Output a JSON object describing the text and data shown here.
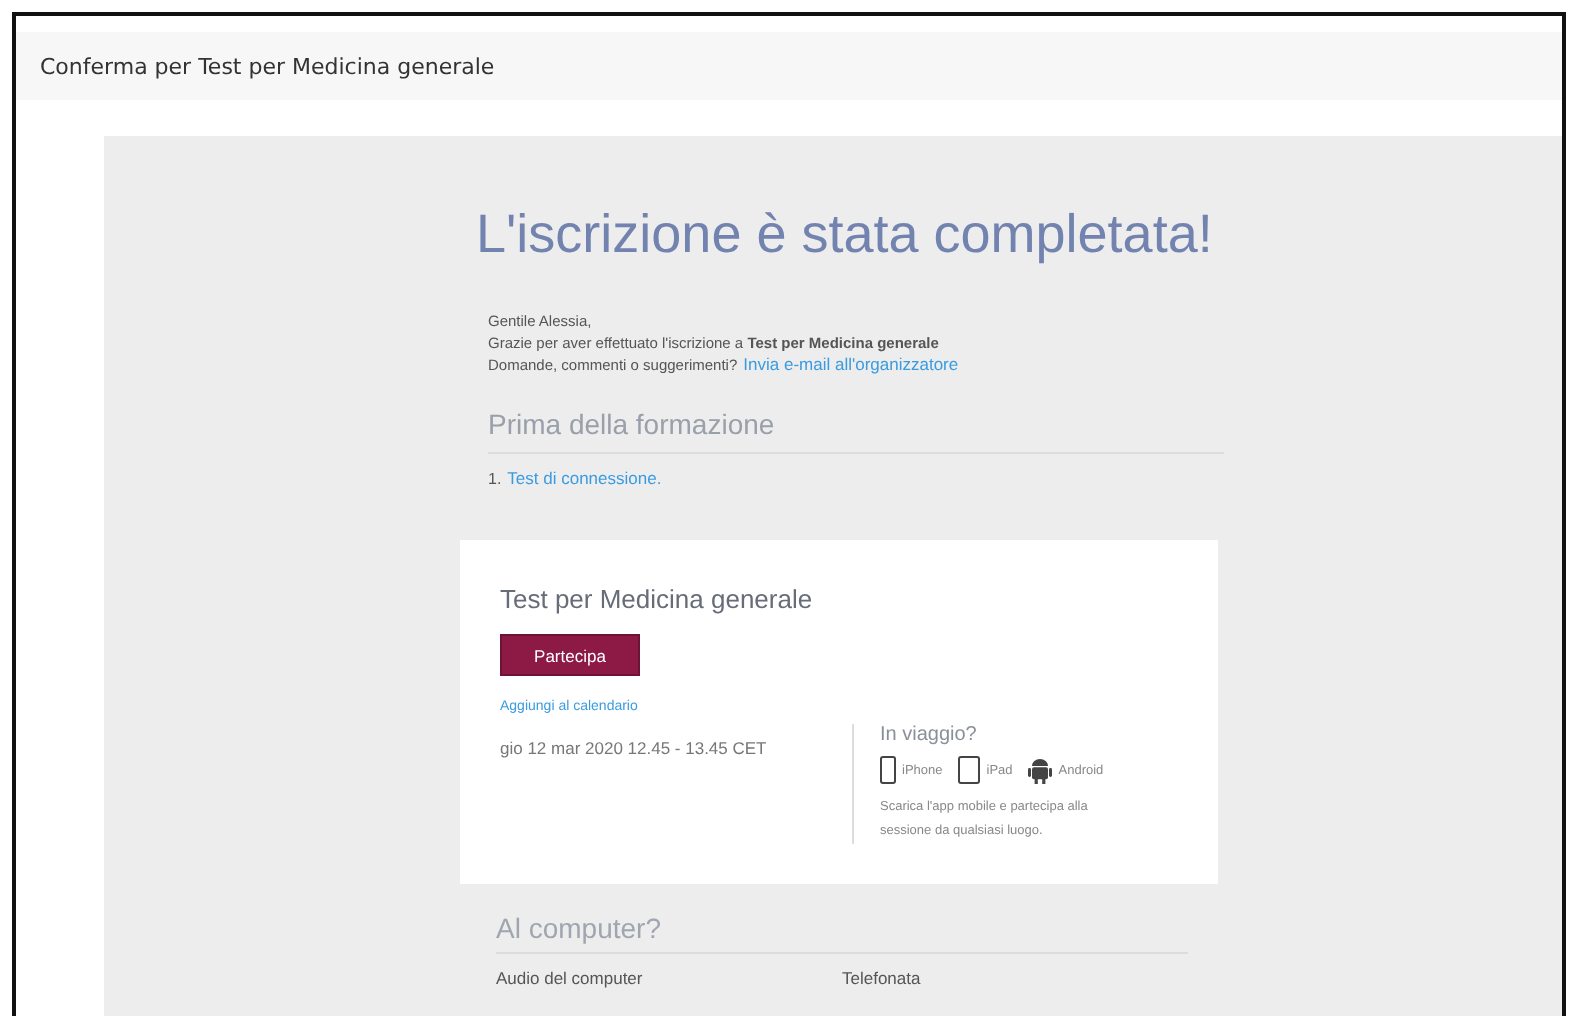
{
  "window": {
    "title": "Conferma per Test per Medicina generale"
  },
  "email": {
    "heading": "L'iscrizione è stata completata!",
    "greeting": "Gentile Alessia,",
    "thanks": "Grazie per aver effettuato l'iscrizione a **Test per Medicina generale**",
    "question": "Domande, commenti o suggerimenti?",
    "contact_link": "Invia e-mail all'organizzatore",
    "before_title": "Prima della formazione",
    "before_items": [
      {
        "number": "1.",
        "link": "Test di connessione."
      }
    ]
  },
  "card": {
    "title": "Test per Medicina generale",
    "join_button": "Partecipa",
    "calendar_link": "Aggiungi al calendario",
    "datetime": "gio 12 mar 2020 12.45 - 13.45 CET",
    "travel_title": "In viaggio?",
    "devices": [
      {
        "kind": "phone",
        "label": "iPhone"
      },
      {
        "kind": "tablet",
        "label": "iPad"
      },
      {
        "kind": "android",
        "label": "Android"
      }
    ],
    "travel_text": "Scarica l'app mobile e partecipa alla sessione da qualsiasi luogo."
  },
  "computer": {
    "title": "Al computer?",
    "columns": [
      "Audio del computer",
      "Telefonata"
    ]
  }
}
